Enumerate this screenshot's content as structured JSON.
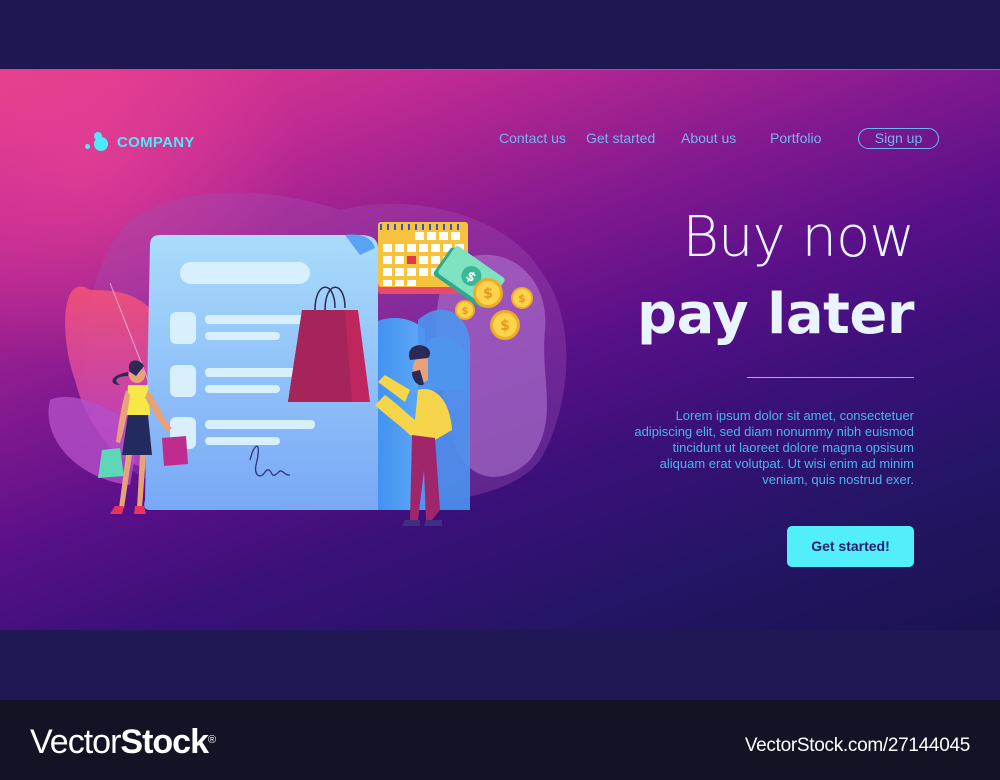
{
  "brand": {
    "name": "COMPANY",
    "icon": "bubble-dots-logo-icon"
  },
  "nav": {
    "items": [
      {
        "label": "Contact us"
      },
      {
        "label": "Get started"
      },
      {
        "label": "About us"
      },
      {
        "label": "Portfolio"
      }
    ],
    "signup_label": "Sign up"
  },
  "hero": {
    "headline_line1": "Buy now",
    "headline_line2": "pay later",
    "body": "Lorem ipsum dolor sit amet, consectetuer adipiscing elit, sed diam nonummy nibh euismod tincidunt ut laoreet dolore magna opsisum aliquam erat volutpat. Ut wisi enim ad minim veniam, quis nostrud exer.",
    "cta_label": "Get started!",
    "illustration": {
      "description": "Woman and man with shopping bags beside a signed receipt, calendar, banknotes and coins",
      "icons": [
        "receipt-document-icon",
        "calendar-icon",
        "shopping-bag-icon",
        "banknote-icon",
        "dollar-coin-icon",
        "signature-icon"
      ]
    }
  },
  "colors": {
    "accent_cyan": "#52eefa",
    "nav_link": "#6fb7f2",
    "body_text": "#4cb4ee",
    "headline": "#e8f4ff",
    "gradient_start": "#e63f8c",
    "gradient_end": "#1a1250",
    "cta_text": "#2a1b70"
  },
  "watermark": {
    "logo_light": "Vector",
    "logo_bold": "Stock",
    "registered": "®",
    "url": "VectorStock.com/27144045"
  }
}
